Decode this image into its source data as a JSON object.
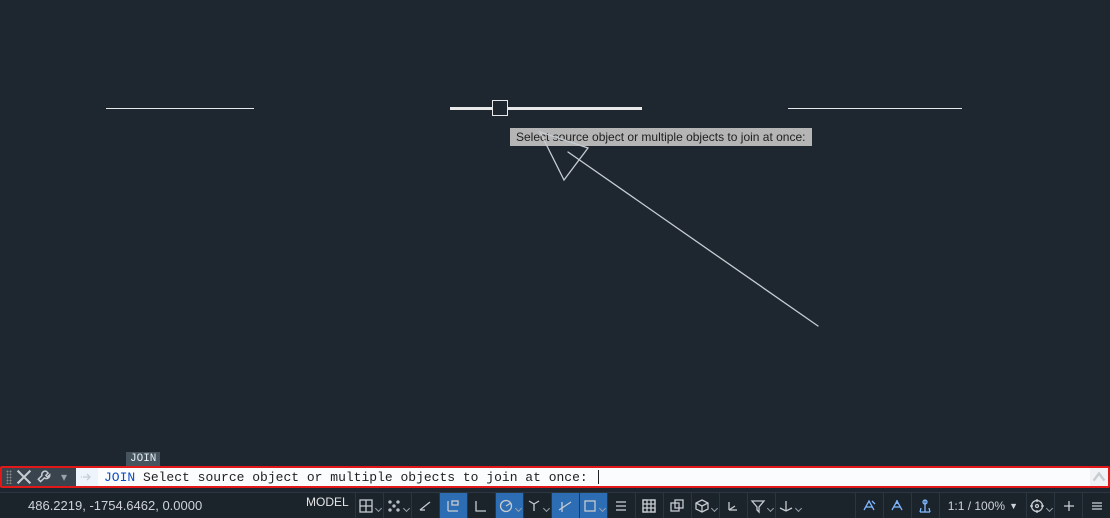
{
  "canvas": {
    "dynamic_prompt": "Select source object or multiple objects to join at once:"
  },
  "command_tag": "JOIN",
  "command_line": {
    "command": "JOIN",
    "prompt": "Select source object or multiple objects to join at once: "
  },
  "status": {
    "coords": "486.2219, -1754.6462, 0.0000",
    "space": "MODEL",
    "scale": "1:1 / 100%"
  },
  "icons": {
    "close": "close-icon",
    "wrench": "wrench-icon",
    "chev": "command-input-icon",
    "history": "history-up-icon"
  }
}
